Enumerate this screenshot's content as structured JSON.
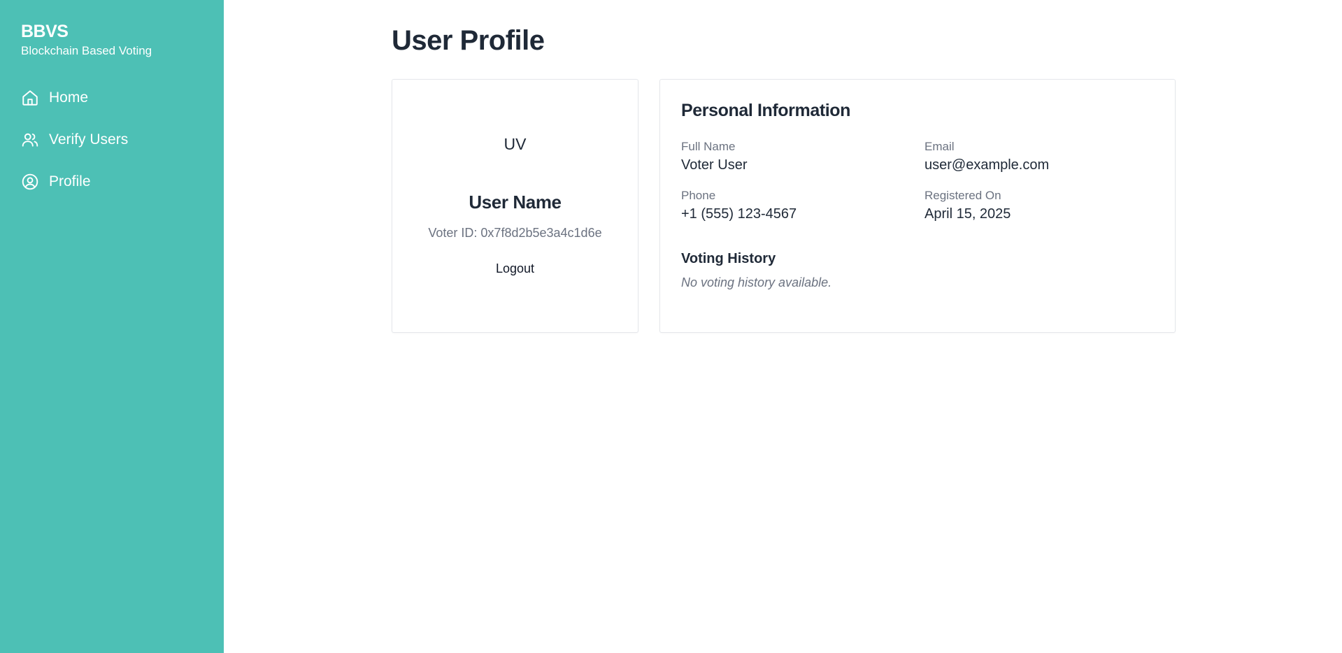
{
  "sidebar": {
    "brand_title": "BBVS",
    "brand_subtitle": "Blockchain Based Voting",
    "items": [
      {
        "label": "Home",
        "icon": "home-icon"
      },
      {
        "label": "Verify Users",
        "icon": "users-icon"
      },
      {
        "label": "Profile",
        "icon": "user-circle-icon"
      }
    ],
    "background_color": "#4dc0b5"
  },
  "main": {
    "page_title": "User Profile",
    "profile_card": {
      "avatar_initials": "UV",
      "user_name": "User Name",
      "voter_id": "Voter ID: 0x7f8d2b5e3a4c1d6e",
      "logout_label": "Logout"
    },
    "info_card": {
      "title": "Personal Information",
      "fields": {
        "full_name": {
          "label": "Full Name",
          "value": "Voter User"
        },
        "email": {
          "label": "Email",
          "value": "user@example.com"
        },
        "phone": {
          "label": "Phone",
          "value": "+1 (555) 123-4567"
        },
        "registered_on": {
          "label": "Registered On",
          "value": "April 15, 2025"
        }
      },
      "voting_history": {
        "title": "Voting History",
        "empty_message": "No voting history available."
      }
    }
  }
}
